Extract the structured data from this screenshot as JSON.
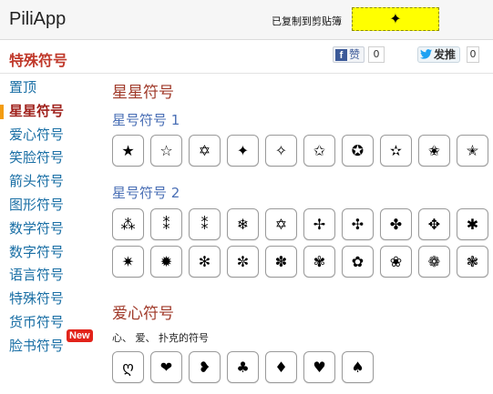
{
  "header": {
    "logo": "PiliApp",
    "copied_label": "已复制到剪贴簿",
    "copied_symbol": "✦"
  },
  "subheader": {
    "title": "特殊符号",
    "fb_label": "赞",
    "fb_count": "0",
    "tw_label": "发推",
    "tw_count": "0"
  },
  "sidebar": {
    "items": [
      {
        "label": "置顶"
      },
      {
        "label": "星星符号"
      },
      {
        "label": "爱心符号"
      },
      {
        "label": "笑脸符号"
      },
      {
        "label": "箭头符号"
      },
      {
        "label": "图形符号"
      },
      {
        "label": "数学符号"
      },
      {
        "label": "数字符号"
      },
      {
        "label": "语言符号"
      },
      {
        "label": "特殊符号"
      },
      {
        "label": "货币符号"
      },
      {
        "label": "脸书符号",
        "badge": "New"
      }
    ]
  },
  "main": {
    "star_section": {
      "title": "星星符号",
      "groups": [
        {
          "title": "星号符号 1",
          "symbols": [
            "★",
            "☆",
            "✡",
            "✦",
            "✧",
            "✩",
            "✪",
            "✫",
            "✬",
            "✭"
          ]
        },
        {
          "title": "星号符号 2",
          "symbols": [
            "⁂",
            "⁑",
            "⁑",
            "❄",
            "✡",
            "✢",
            "✣",
            "✤",
            "✥",
            "✱",
            "✷",
            "✹",
            "✻",
            "✼",
            "✽",
            "✾",
            "✿",
            "❀",
            "❁",
            "❃"
          ]
        }
      ]
    },
    "heart_section": {
      "title": "爱心符号",
      "desc": "心、 爱、 扑克的符号",
      "symbols": [
        "ღ",
        "❤",
        "❥",
        "♣",
        "♦",
        "♥",
        "♠"
      ]
    }
  },
  "colors": {
    "copy_box": "#ffff00",
    "active_nav": "#a0221d",
    "nav_link": "#1a6fa5",
    "section_title": "#a03a2a",
    "group_title": "#4a6fb5",
    "new_badge": "#e2231a",
    "active_marker": "#f39c12"
  },
  "icons": {
    "fb": "facebook-icon",
    "tw": "twitter-bird-icon"
  }
}
